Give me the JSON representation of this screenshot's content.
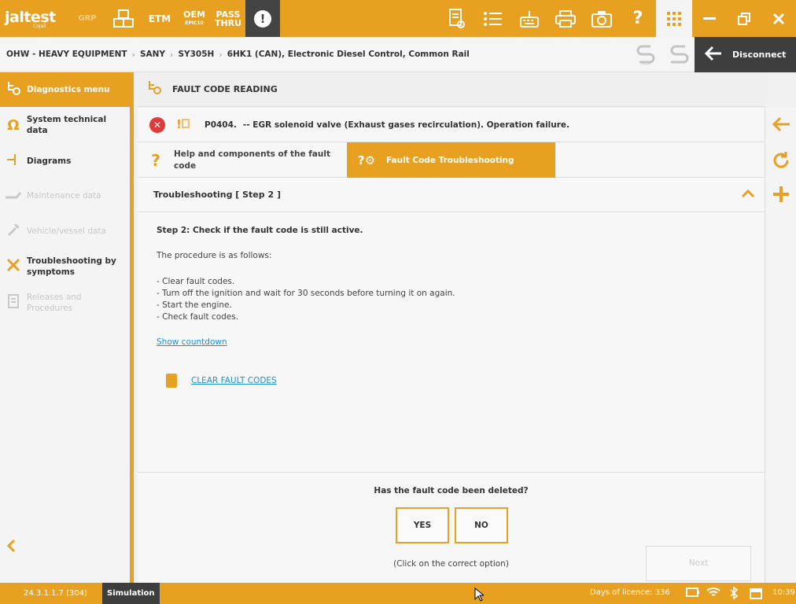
{
  "topbar": {
    "logo_brand": "jaltest",
    "logo_sub": "Cojali",
    "grp": "GRP",
    "etm": "ETM",
    "oem_line1": "OEM",
    "oem_line2": "EPIC10",
    "pass_line1": "PASS",
    "pass_line2": "THRU",
    "alert_glyph": "!"
  },
  "breadcrumb": {
    "items": [
      "OHW - HEAVY EQUIPMENT",
      "SANY",
      "SY305H",
      "6HK1 (CAN), Electronic Diesel Control, Common Rail"
    ]
  },
  "disconnect_label": "Disconnect",
  "sidebar": {
    "items": [
      {
        "label": "Diagnostics menu",
        "state": "active"
      },
      {
        "label": "System technical data",
        "state": "enabled"
      },
      {
        "label": "Diagrams",
        "state": "enabled"
      },
      {
        "label": "Maintenance data",
        "state": "disabled"
      },
      {
        "label": "Vehicle/vessel data",
        "state": "disabled"
      },
      {
        "label": "Troubleshooting by symptoms",
        "state": "enabled"
      },
      {
        "label": "Releases and Procedures",
        "state": "disabled"
      }
    ]
  },
  "panel": {
    "title": "FAULT CODE READING"
  },
  "fault": {
    "code": "P0404.",
    "description": "--  EGR solenoid valve (Exhaust gases recirculation). Operation failure."
  },
  "tabs": {
    "help_label": "Help and components of the fault code",
    "troubleshooting_label": "Fault Code Troubleshooting"
  },
  "step": {
    "header": "Troubleshooting [ Step 2 ]",
    "title": "Step 2: Check if the fault code is still active.",
    "intro": "The procedure is as follows:",
    "lines": [
      "- Clear fault codes.",
      "- Turn off the ignition and wait for 30 seconds before turning it on again.",
      "- Start the engine.",
      "- Check fault codes."
    ],
    "countdown_link": "Show countdown",
    "clear_link": "CLEAR FAULT CODES"
  },
  "question": {
    "text": "Has the fault code been deleted?",
    "yes": "YES",
    "no": "NO",
    "hint": "(Click on the correct option)",
    "next": "Next"
  },
  "status": {
    "version": "24.3.1.1.7 (304)",
    "mode": "Simulation",
    "licence": "Days of licence: 336",
    "time": "10:39"
  },
  "colors": {
    "accent": "#e8a020",
    "dark": "#3e3e3e",
    "link": "#1f8fd1",
    "error": "#e03a3a"
  }
}
